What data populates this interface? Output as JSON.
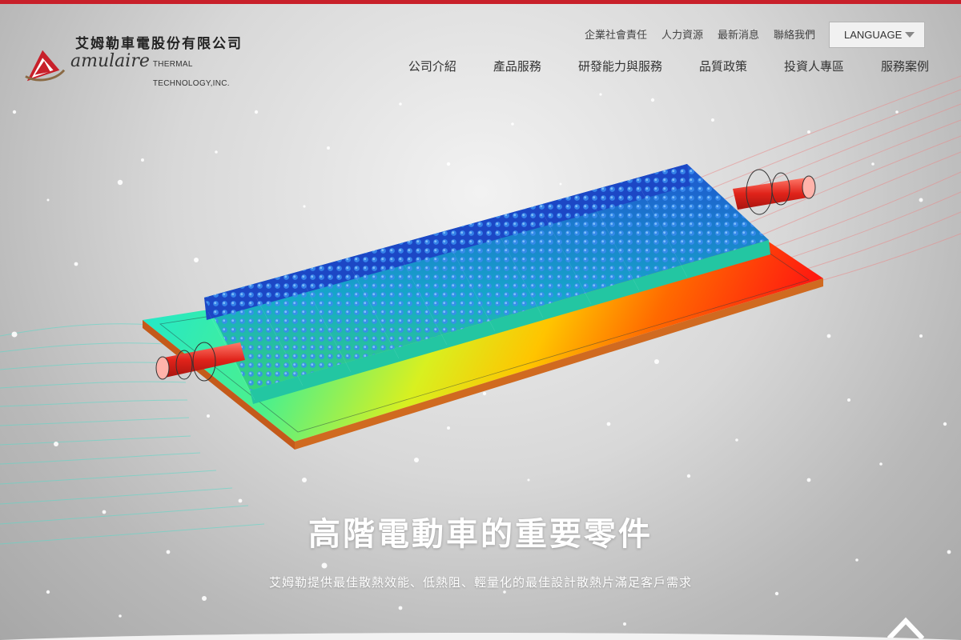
{
  "brand": {
    "name_cn": "艾姆勒車電股份有限公司",
    "name_en": "amulaire",
    "name_en_sub": "THERMAL TECHNOLOGY,INC.",
    "logo_color": "#c8202a"
  },
  "util_nav": {
    "items": [
      {
        "label": "企業社會責任"
      },
      {
        "label": "人力資源"
      },
      {
        "label": "最新消息"
      },
      {
        "label": "聯絡我們"
      }
    ]
  },
  "language": {
    "selected": "LANGUAGE",
    "icon": "chevron-down-icon"
  },
  "main_nav": {
    "items": [
      {
        "label": "公司介紹"
      },
      {
        "label": "產品服務"
      },
      {
        "label": "研發能力與服務"
      },
      {
        "label": "品質政策"
      },
      {
        "label": "投資人專區"
      },
      {
        "label": "服務案例"
      }
    ]
  },
  "hero": {
    "headline": "高階電動車的重要零件",
    "subline": "艾姆勒提供最佳散熱效能、低熱阻、輕量化的最佳設計散熱片滿足客戶需求",
    "image_subject": "pin-fin cold plate thermal simulation"
  },
  "scroll_top": {
    "icon": "chevron-up-icon"
  },
  "colors": {
    "accent": "#c8202a",
    "headline_text": "#ffffff",
    "nav_text": "#333333"
  }
}
